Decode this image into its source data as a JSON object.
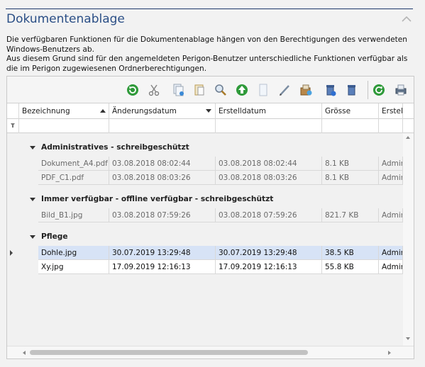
{
  "panel": {
    "title": "Dokumentenablage",
    "description": [
      "Die verfügbaren Funktionen für die Dokumentenablage hängen von den Berechtigungen des verwendeten Windows-Benutzers ab.",
      "Aus diesem Grund sind für den angemeldeten Perigon-Benutzer unterschiedliche Funktionen verfügbar als die im Perigon zugewiesenen Ordnerberechtigungen."
    ]
  },
  "toolbar": {
    "buttons": [
      {
        "icon": "refresh-icon"
      },
      {
        "icon": "cut-icon"
      },
      {
        "icon": "copy-document-icon"
      },
      {
        "icon": "paste-document-icon"
      },
      {
        "icon": "search-icon"
      },
      {
        "icon": "upload-icon"
      },
      {
        "icon": "new-document-icon"
      },
      {
        "icon": "edit-pencil-icon"
      },
      {
        "icon": "archive-box-icon"
      },
      {
        "icon": "delete-bin-icon"
      },
      {
        "icon": "delete-bin-alt-icon"
      },
      {
        "icon": "reload-icon"
      },
      {
        "icon": "print-icon"
      }
    ]
  },
  "columns": [
    {
      "label": "Bezeichnung",
      "sort": "asc"
    },
    {
      "label": "Änderungsdatum",
      "sort": "desc"
    },
    {
      "label": "Erstelldatum",
      "sort": ""
    },
    {
      "label": "Grösse",
      "sort": ""
    },
    {
      "label": "Erstell",
      "sort": ""
    }
  ],
  "groups": [
    {
      "label": "Administratives - schreibgeschützt",
      "rows": [
        {
          "name": "Dokument_A4.pdf",
          "modified": "03.08.2018 08:02:44",
          "created": "03.08.2018 08:02:44",
          "size": "8.1 KB",
          "creator": "Admin"
        },
        {
          "name": "PDF_C1.pdf",
          "modified": "03.08.2018 08:03:26",
          "created": "03.08.2018 08:03:26",
          "size": "8.1 KB",
          "creator": "Admin"
        }
      ]
    },
    {
      "label": "Immer verfügbar - offline verfügbar - schreibgeschützt",
      "rows": [
        {
          "name": "Bild_B1.jpg",
          "modified": "03.08.2018 07:59:26",
          "created": "03.08.2018 07:59:26",
          "size": "821.7 KB",
          "creator": "Admin"
        }
      ]
    },
    {
      "label": "Pflege",
      "rows": [
        {
          "name": "Dohle.jpg",
          "modified": "30.07.2019 13:29:48",
          "created": "30.07.2019 13:29:48",
          "size": "38.5 KB",
          "creator": "Admin"
        },
        {
          "name": "Xy.jpg",
          "modified": "17.09.2019 12:16:13",
          "created": "17.09.2019 12:16:13",
          "size": "55.8 KB",
          "creator": "Admin"
        }
      ]
    }
  ],
  "colors": {
    "title": "#2b4f86",
    "selected_row": "#d7e3f6",
    "readonly_text": "#6a6a6a"
  }
}
